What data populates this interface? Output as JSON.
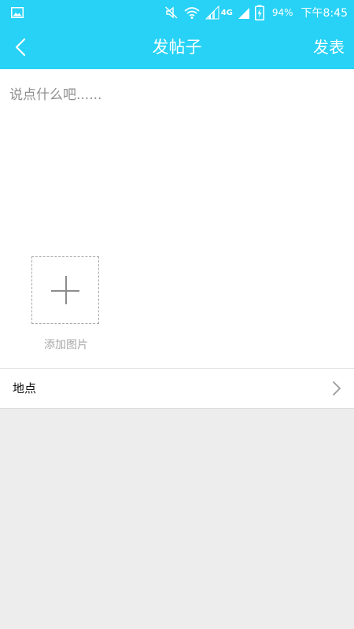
{
  "status_bar": {
    "battery_percent": "94%",
    "network": "4G",
    "time": "下午8:45",
    "icons": [
      "gallery-icon",
      "mute-icon",
      "wifi-icon",
      "signal-icon",
      "charging-battery-icon"
    ]
  },
  "header": {
    "title": "发帖子",
    "back_icon": "chevron-left-icon",
    "publish_label": "发表"
  },
  "compose": {
    "placeholder": "说点什么吧......",
    "value": "",
    "add_image_label": "添加图片",
    "add_image_icon": "plus-icon"
  },
  "location": {
    "label": "地点",
    "icon": "chevron-right-icon"
  },
  "colors": {
    "accent": "#27d2f6",
    "background": "#ededed",
    "surface": "#ffffff"
  }
}
